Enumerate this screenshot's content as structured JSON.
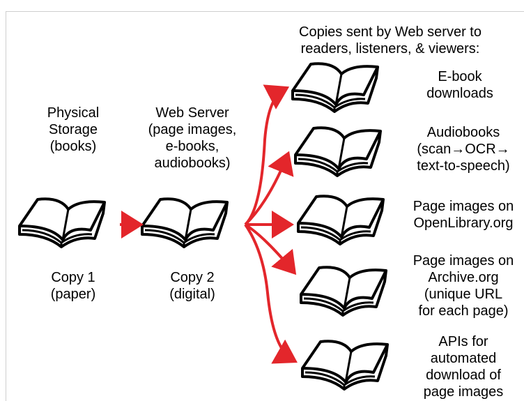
{
  "top_header": "Copies sent by Web server to\nreaders, listeners, & viewers:",
  "physical": {
    "title": "Physical\nStorage\n(books)",
    "caption": "Copy 1\n(paper)"
  },
  "server": {
    "title": "Web Server\n(page images,\ne-books,\naudiobooks)",
    "caption": "Copy 2\n(digital)"
  },
  "outputs": [
    "E-book\ndownloads",
    "Audiobooks\n(scan→OCR→\ntext-to-speech)",
    "Page images on\nOpenLibrary.org",
    "Page images on\nArchive.org\n(unique URL\nfor each page)",
    "APIs for\nautomated\ndownload of\npage images"
  ],
  "colors": {
    "arrow": "#e3262b",
    "book_stroke": "#000000",
    "book_fill": "#ffffff"
  }
}
